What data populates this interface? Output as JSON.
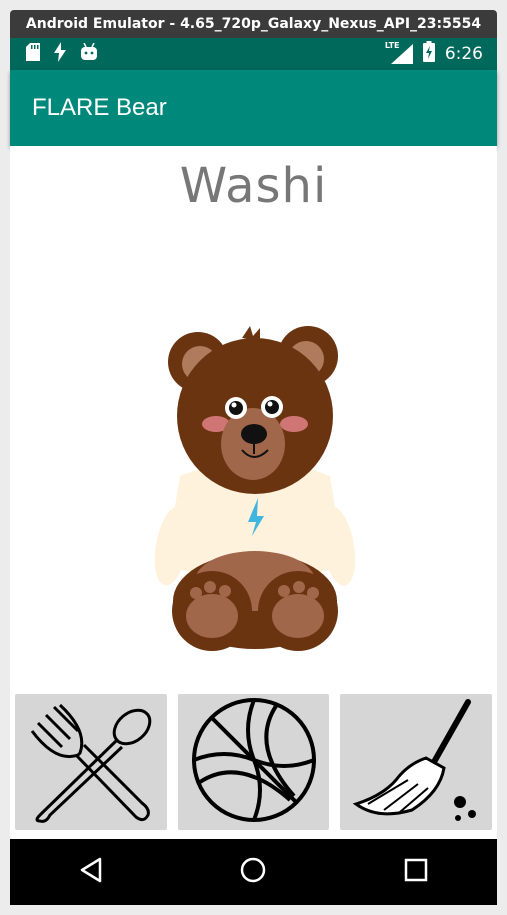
{
  "window": {
    "title": "Android Emulator - 4.65_720p_Galaxy_Nexus_API_23:5554"
  },
  "status_bar": {
    "icons_left": [
      "sd-card-icon",
      "flash-icon",
      "android-icon"
    ],
    "network_label": "LTE",
    "icons_right": [
      "signal-icon",
      "battery-icon"
    ],
    "time": "6:26",
    "color": "#00695c"
  },
  "app_bar": {
    "title": "FLARE Bear",
    "color": "#00897b"
  },
  "main": {
    "bear_name": "Washi",
    "bear_image": "bear-icon",
    "actions": [
      {
        "name": "feed",
        "icon": "fork-spoon-icon"
      },
      {
        "name": "play",
        "icon": "basketball-icon"
      },
      {
        "name": "clean",
        "icon": "broom-icon"
      }
    ]
  },
  "nav_bar": {
    "buttons": [
      "back-icon",
      "home-icon",
      "recents-icon"
    ]
  }
}
